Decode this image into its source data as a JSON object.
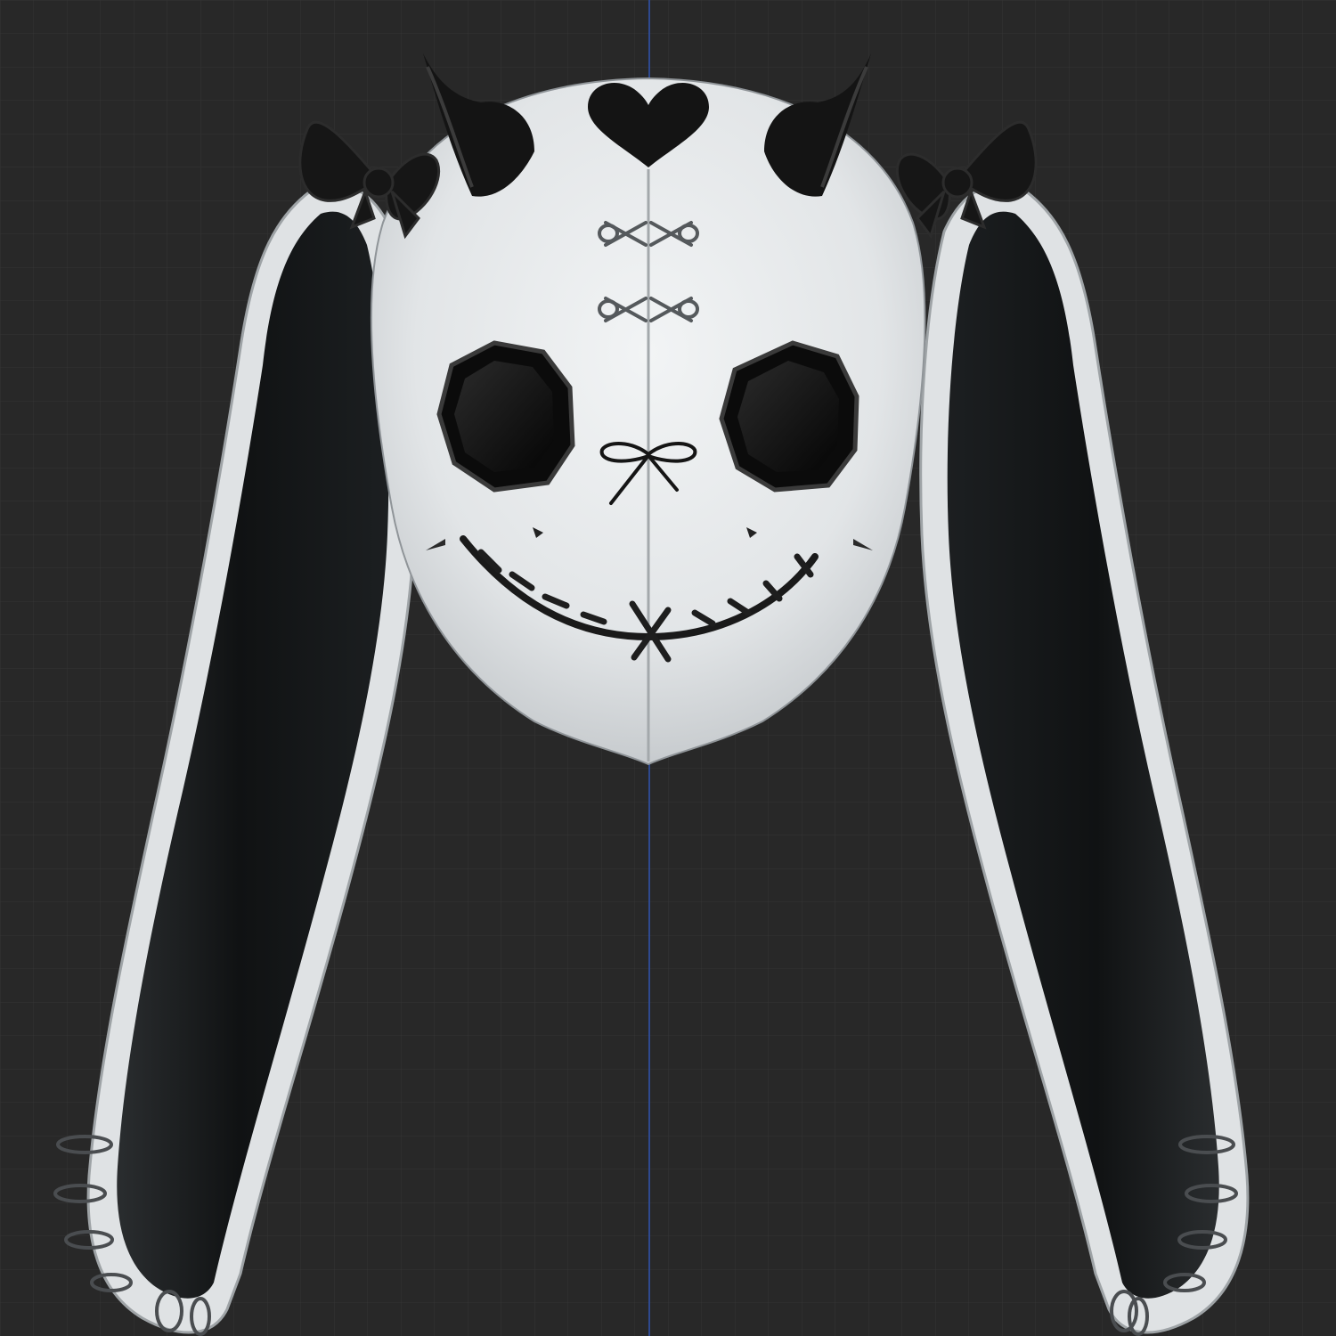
{
  "viewport": {
    "background_color": "#282828",
    "grid_line_color": "#363636",
    "axis_color": "#2f4d9a"
  },
  "model": {
    "subject": "bunny-mask-3d-model",
    "mask_color": "#e6e8ea",
    "ear_inner_color": "#141617",
    "accent_color": "#121212",
    "icons": [
      "heart-icon",
      "horn-icon",
      "bow-icon",
      "safety-pin-icon",
      "stitch-icon"
    ]
  }
}
